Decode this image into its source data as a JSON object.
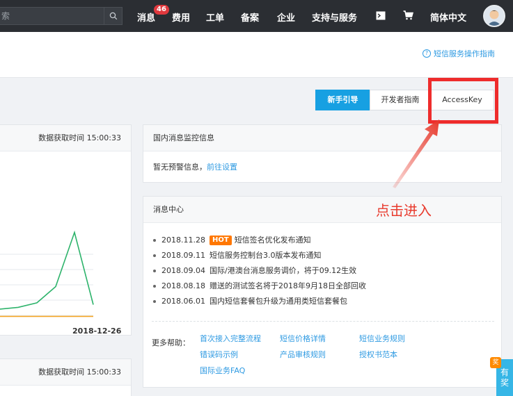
{
  "topbar": {
    "search_placeholder": "索",
    "nav": {
      "messages": "消息",
      "messages_badge": "46",
      "fees": "费用",
      "tickets": "工单",
      "filing": "备案",
      "enterprise": "企业",
      "support": "支持与服务",
      "language": "简体中文"
    },
    "icons": [
      "search-icon",
      "terminal-icon",
      "cart-icon",
      "avatar"
    ]
  },
  "header": {
    "help_link": "短信服务操作指南"
  },
  "tabs": {
    "newbie": "新手引导",
    "developer": "开发者指南",
    "accesskey": "AccessKey"
  },
  "annotation": "点击进入",
  "left_panel_top": {
    "fetch_time": "数据获取时间 15:00:33",
    "x_end_label": "2018-12-26"
  },
  "left_panel_bottom": {
    "fetch_time": "数据获取时间 15:00:33"
  },
  "monitor": {
    "title": "国内消息监控信息",
    "no_alert": "暂无预警信息，",
    "goto_settings": "前往设置"
  },
  "message_center": {
    "title": "消息中心",
    "items": [
      {
        "date": "2018.11.28",
        "hot": "HOT",
        "text": "短信签名优化发布通知"
      },
      {
        "date": "2018.09.11",
        "text": "短信服务控制台3.0版本发布通知"
      },
      {
        "date": "2018.09.04",
        "text": "国际/港澳台消息服务调价，将于09.12生效"
      },
      {
        "date": "2018.08.18",
        "text": "赠送的测试签名将于2018年9月18日全部回收"
      },
      {
        "date": "2018.06.01",
        "text": "国内短信套餐包升级为通用类短信套餐包"
      }
    ],
    "more_help_label": "更多帮助：",
    "help_links": [
      "首次接入完整流程",
      "短信价格详情",
      "短信业务规则",
      "错误码示例",
      "产品审核规则",
      "授权书范本",
      "国际业务FAQ"
    ]
  },
  "float": {
    "tag": "奖",
    "text1": "有",
    "text2": "奖"
  },
  "chart_data": {
    "type": "line",
    "series": [
      {
        "color": "#2db36b",
        "values": [
          0.1,
          0.12,
          0.17,
          0.35,
          0.95,
          0.15
        ]
      },
      {
        "color": "#f5a623",
        "values": [
          0.02,
          0.02,
          0.02,
          0.02,
          0.02,
          0.02
        ]
      }
    ],
    "grid": true,
    "colors": {
      "green": "#2db36b",
      "orange": "#f5a623"
    }
  }
}
